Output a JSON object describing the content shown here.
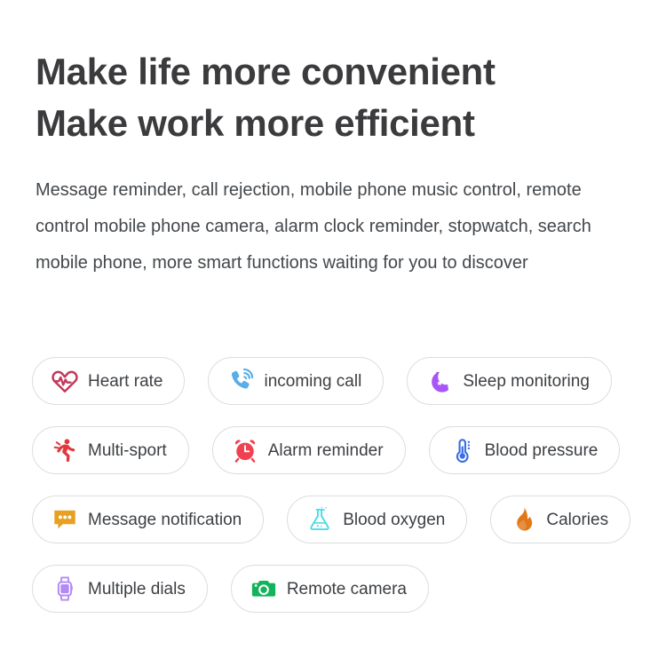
{
  "headline": {
    "line1": "Make life more convenient",
    "line2": "Make work more efficient"
  },
  "subcopy": {
    "text": "Message reminder, call rejection, mobile phone music control, remote control mobile phone camera, alarm clock reminder, stopwatch, search mobile phone, more smart functions waiting for you to discover"
  },
  "colors": {
    "heading": "#3b3b3d",
    "body": "#43474b",
    "pill_border": "#dcdde0",
    "pill_background": "#ffffff",
    "heart_rate": "#c2385a",
    "incoming_call": "#58aee8",
    "sleep_monitoring": "#a855f7",
    "multi_sport": "#e0393e",
    "alarm_reminder": "#f04150",
    "blood_pressure": "#3b6fe0",
    "message_notification": "#e8a020",
    "blood_oxygen": "#4fdce6",
    "calories": "#e07818",
    "multiple_dials": "#b389f5",
    "remote_camera": "#12b council"
  },
  "features": [
    {
      "id": "heart-rate",
      "label": "Heart rate",
      "icon": "heart-rate-icon",
      "color": "#c2385a"
    },
    {
      "id": "incoming-call",
      "label": "incoming call",
      "icon": "incoming-call-icon",
      "color": "#58aee8"
    },
    {
      "id": "sleep-monitoring",
      "label": "Sleep monitoring",
      "icon": "sleep-moon-icon",
      "color": "#a855f7"
    },
    {
      "id": "multi-sport",
      "label": "Multi-sport",
      "icon": "running-person-icon",
      "color": "#e0393e"
    },
    {
      "id": "alarm-reminder",
      "label": "Alarm reminder",
      "icon": "alarm-clock-icon",
      "color": "#f04150"
    },
    {
      "id": "blood-pressure",
      "label": "Blood pressure",
      "icon": "thermometer-icon",
      "color": "#3b6fe0"
    },
    {
      "id": "message-notification",
      "label": "Message notification",
      "icon": "speech-bubble-icon",
      "color": "#e8a020"
    },
    {
      "id": "blood-oxygen",
      "label": "Blood oxygen",
      "icon": "flask-icon",
      "color": "#4fdce6"
    },
    {
      "id": "calories",
      "label": "Calories",
      "icon": "flame-icon",
      "color": "#e07818"
    },
    {
      "id": "multiple-dials",
      "label": "Multiple dials",
      "icon": "smartwatch-icon",
      "color": "#b389f5"
    },
    {
      "id": "remote-camera",
      "label": "Remote camera",
      "icon": "camera-icon",
      "color": "#12b35a"
    }
  ]
}
